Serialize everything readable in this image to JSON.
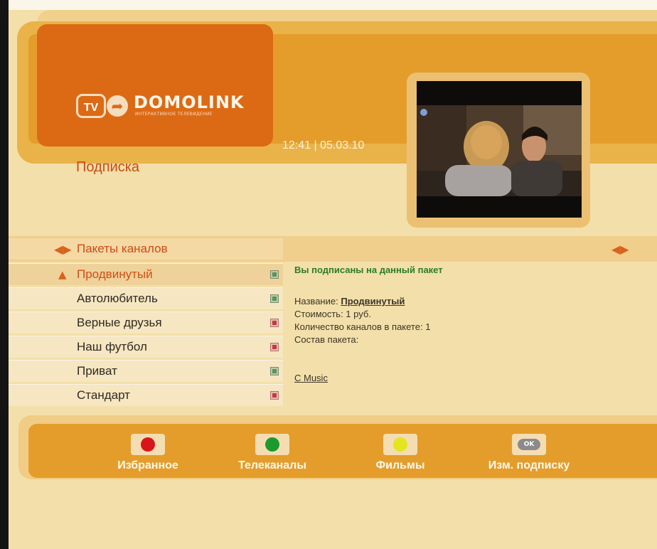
{
  "header": {
    "logo_tv": "TV",
    "logo_brand": "DOMOLINK",
    "logo_tagline": "ИНТЕРАКТИВНОЕ ТЕЛЕВИДЕНИЕ",
    "clock": "12:41 | 05.03.10",
    "title": "Подписка"
  },
  "menu": {
    "section_label": "Пакеты каналов",
    "items": [
      {
        "label": "Продвинутый",
        "subscribed": true,
        "selected": true
      },
      {
        "label": "Автолюбитель",
        "subscribed": true,
        "selected": false
      },
      {
        "label": "Верные друзья",
        "subscribed": false,
        "selected": false
      },
      {
        "label": "Наш футбол",
        "subscribed": false,
        "selected": false
      },
      {
        "label": "Приват",
        "subscribed": true,
        "selected": false
      },
      {
        "label": "Стандарт",
        "subscribed": false,
        "selected": false
      }
    ]
  },
  "details": {
    "status": "Вы подписаны на данный пакет",
    "name_label": "Название:",
    "name_value": "Продвинутый",
    "cost": "Стоимость: 1 руб.",
    "channels_count": "Количество каналов в пакете: 1",
    "composition": "Состав пакета:",
    "channel": "C Music"
  },
  "buttons": [
    {
      "label": "Избранное",
      "color": "#d8161a"
    },
    {
      "label": "Телеканалы",
      "color": "#1b9b2f"
    },
    {
      "label": "Фильмы",
      "color": "#e3e51f"
    },
    {
      "label": "Изм. подписку",
      "key": "OK"
    }
  ],
  "colors": {
    "accent": "#dc6a15",
    "subscribed": "#57955a",
    "not_subscribed": "#c43a39"
  }
}
